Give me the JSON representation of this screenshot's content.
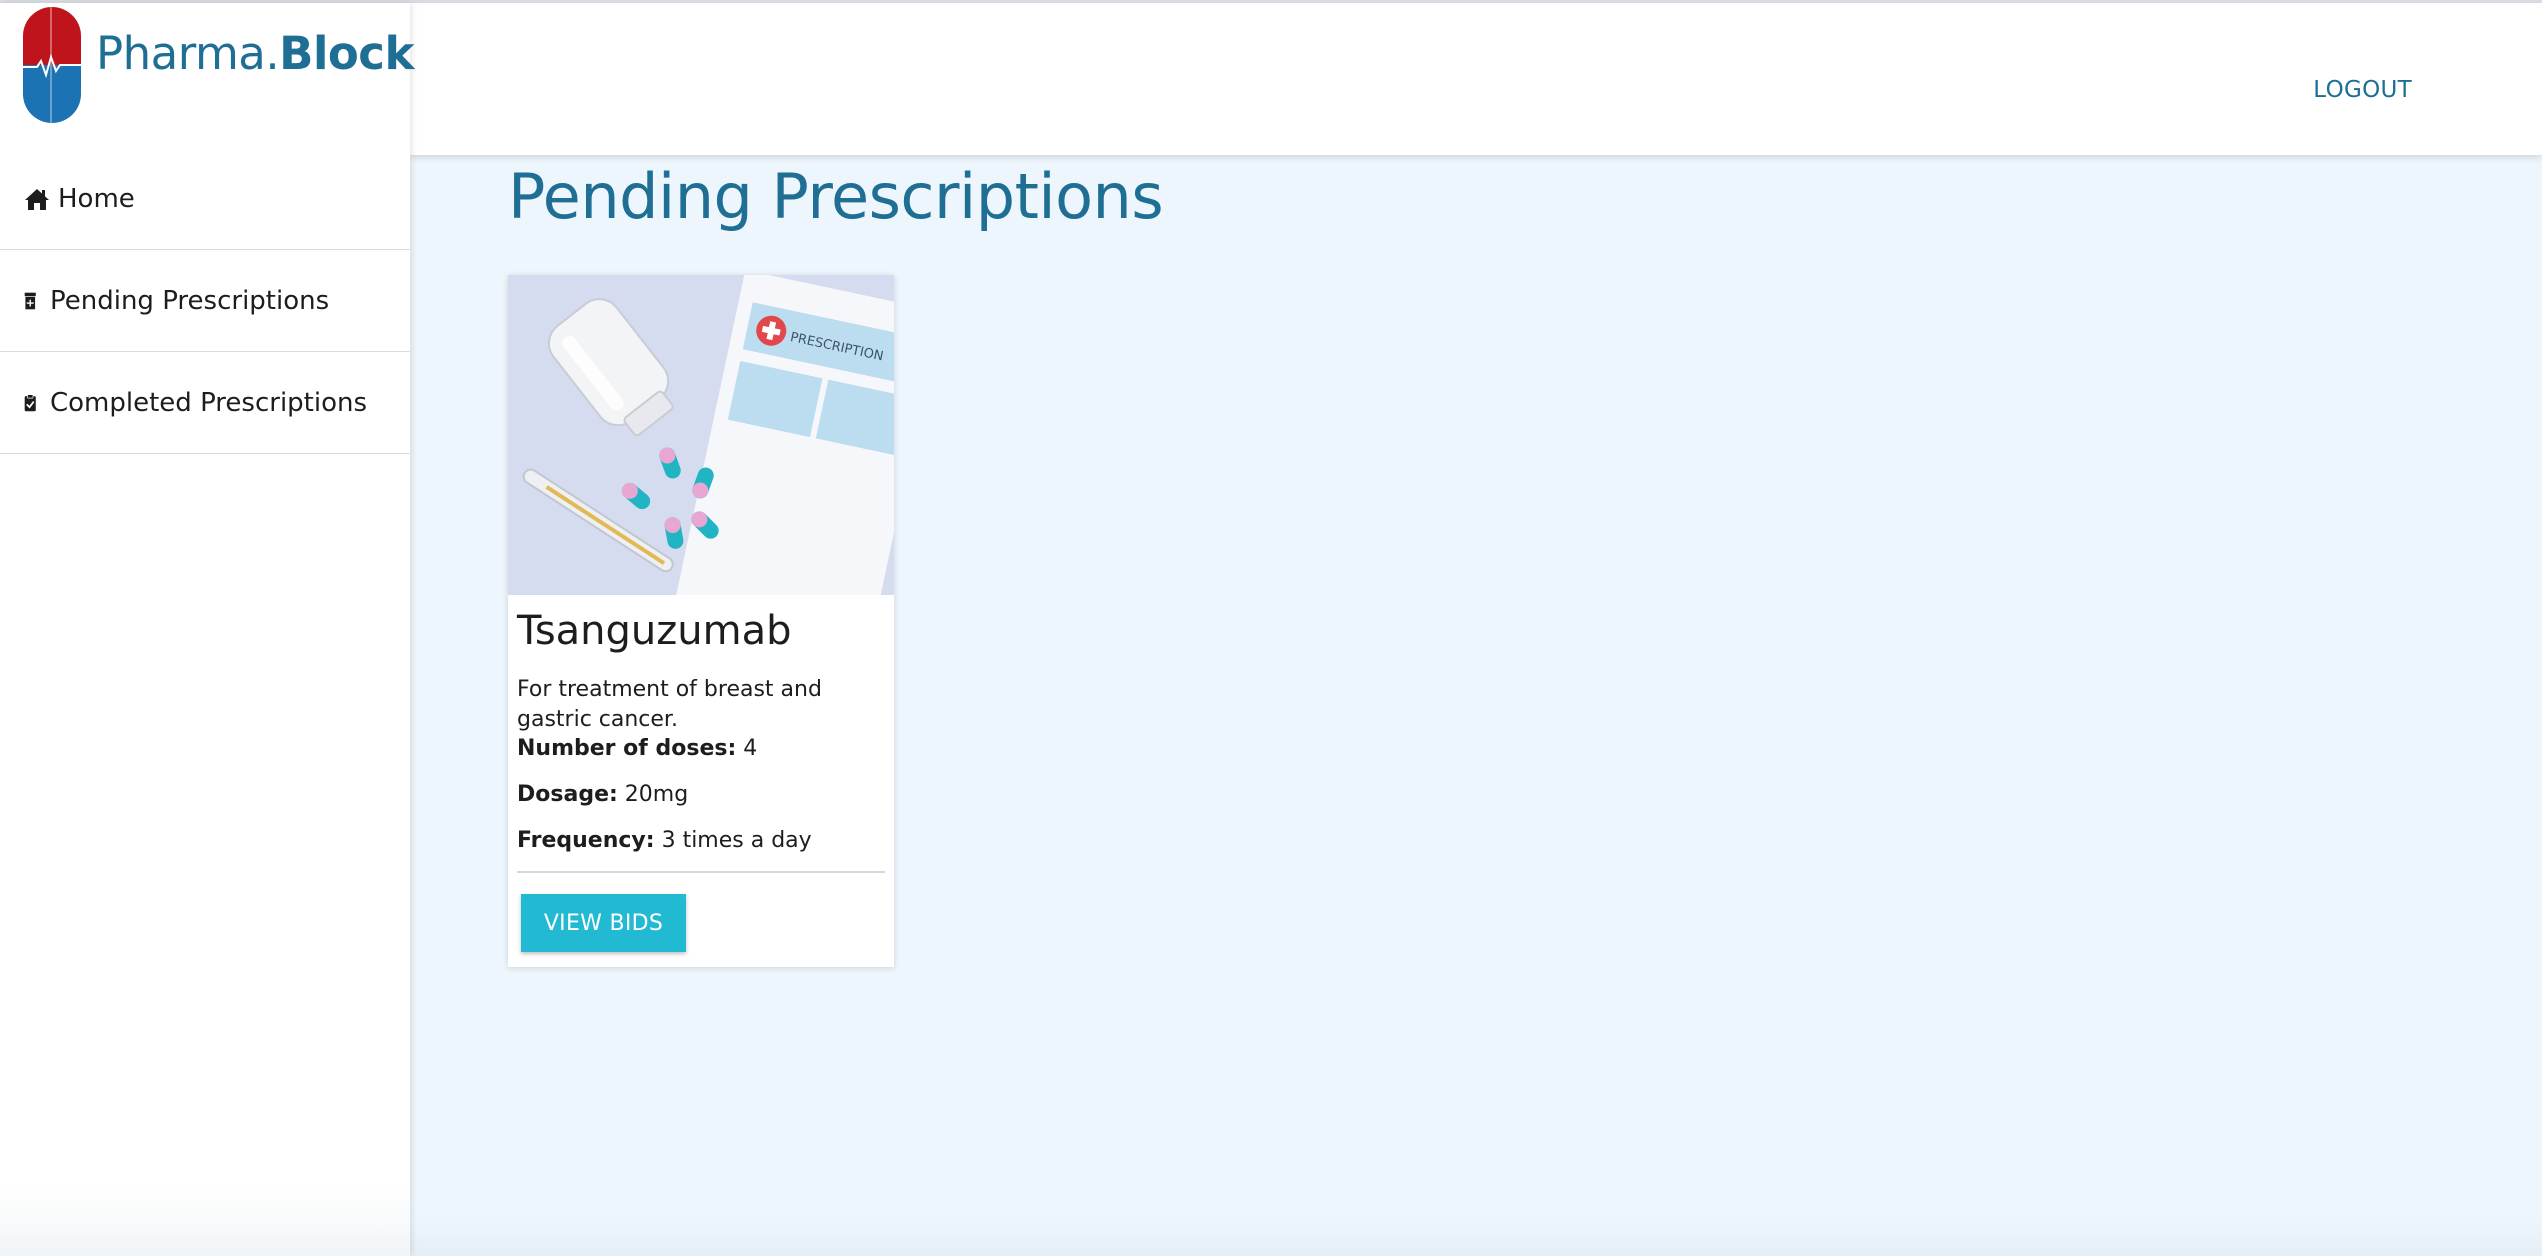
{
  "brand": {
    "name_light": "Pharma.",
    "name_bold": "Block",
    "logo_icon": "pill-capsule-heartbeat-icon",
    "colors": {
      "top": "#c0141c",
      "bottom": "#1b73b3"
    }
  },
  "sidebar": {
    "items": [
      {
        "label": "Home",
        "icon": "home-icon"
      },
      {
        "label": "Pending Prescriptions",
        "icon": "prescription-bottle-icon"
      },
      {
        "label": "Completed Prescriptions",
        "icon": "clipboard-check-icon"
      }
    ]
  },
  "header": {
    "logout_label": "LOGOUT"
  },
  "main": {
    "title": "Pending Prescriptions",
    "cards": [
      {
        "image_label": "PRESCRIPTION",
        "title": "Tsanguzumab",
        "description": "For treatment of breast and gastric cancer.",
        "doses_label": "Number of doses:",
        "doses_value": "4",
        "dosage_label": "Dosage:",
        "dosage_value": "20mg",
        "frequency_label": "Frequency:",
        "frequency_value": "3 times a day",
        "button_label": "VIEW BIDS"
      }
    ]
  },
  "colors": {
    "accent": "#1f6e93",
    "button": "#22b9d2",
    "background": "#eef6fd"
  }
}
